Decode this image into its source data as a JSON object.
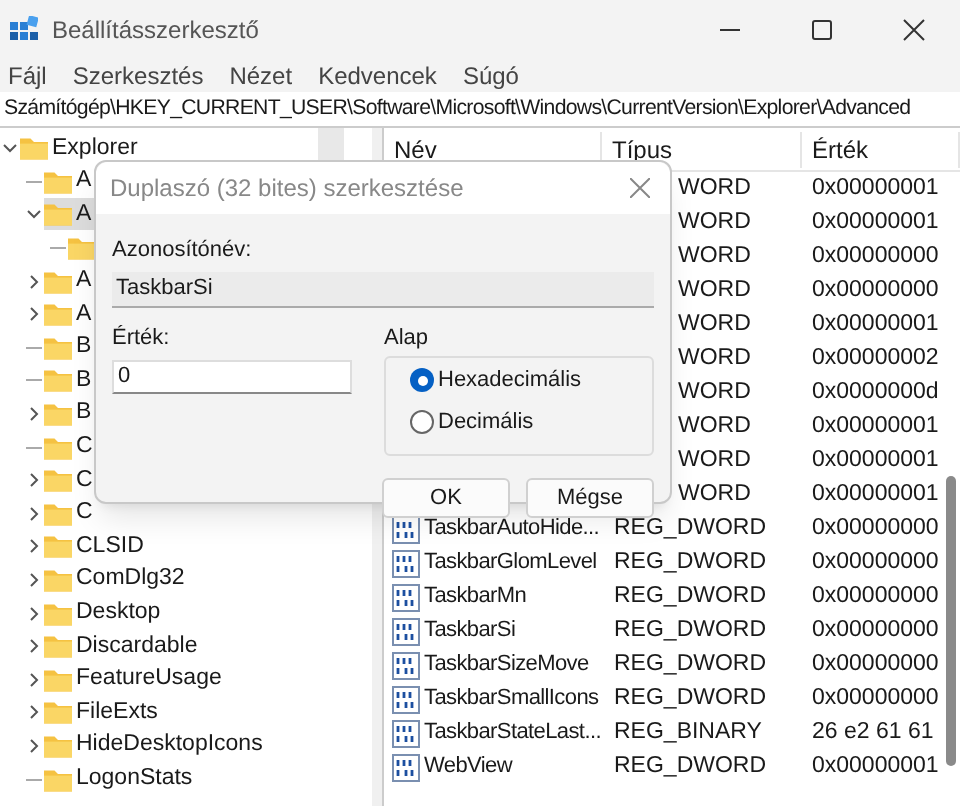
{
  "window": {
    "title": "Beállításszerkesztő"
  },
  "menu": [
    "Fájl",
    "Szerkesztés",
    "Nézet",
    "Kedvencek",
    "Súgó"
  ],
  "address": "Számítógép\\HKEY_CURRENT_USER\\Software\\Microsoft\\Windows\\CurrentVersion\\Explorer\\Advanced",
  "tree": [
    {
      "label": "Explorer",
      "kind": "expandable",
      "expanded": true,
      "selected": false,
      "children": [
        {
          "label": "A",
          "kind": "leaf",
          "selected": false
        },
        {
          "label": "A",
          "kind": "expandable",
          "expanded": true,
          "selected": true,
          "children": [
            {
              "kind": "leaf",
              "selected": false
            }
          ]
        },
        {
          "label": "A",
          "kind": "expandable",
          "expanded": false,
          "selected": false
        },
        {
          "label": "A",
          "kind": "expandable",
          "expanded": false,
          "selected": false
        },
        {
          "label": "B",
          "kind": "leaf",
          "selected": false
        },
        {
          "label": "B",
          "kind": "leaf",
          "selected": false
        },
        {
          "label": "B",
          "kind": "expandable",
          "expanded": false,
          "selected": false
        },
        {
          "label": "C",
          "kind": "leaf",
          "selected": false
        },
        {
          "label": "C",
          "kind": "expandable",
          "expanded": false,
          "selected": false
        },
        {
          "label": "C",
          "kind": "expandable",
          "expanded": false,
          "selected": false
        },
        {
          "label": "CLSID",
          "kind": "expandable",
          "expanded": false,
          "selected": false
        },
        {
          "label": "ComDlg32",
          "kind": "expandable",
          "expanded": false,
          "selected": false
        },
        {
          "label": "Desktop",
          "kind": "expandable",
          "expanded": false,
          "selected": false
        },
        {
          "label": "Discardable",
          "kind": "expandable",
          "expanded": false,
          "selected": false
        },
        {
          "label": "FeatureUsage",
          "kind": "expandable",
          "expanded": false,
          "selected": false
        },
        {
          "label": "FileExts",
          "kind": "expandable",
          "expanded": false,
          "selected": false
        },
        {
          "label": "HideDesktopIcons",
          "kind": "expandable",
          "expanded": false,
          "selected": false
        },
        {
          "label": "LogonStats",
          "kind": "leaf",
          "selected": false
        }
      ]
    }
  ],
  "table": {
    "columns": [
      "Név",
      "Típus",
      "Érték"
    ],
    "rows": [
      {
        "type": "WORD",
        "value": "0x00000001"
      },
      {
        "type": "WORD",
        "value": "0x00000001"
      },
      {
        "type": "WORD",
        "value": "0x00000000"
      },
      {
        "type": "WORD",
        "value": "0x00000000"
      },
      {
        "type": "WORD",
        "value": "0x00000001"
      },
      {
        "type": "WORD",
        "value": "0x00000002"
      },
      {
        "type": "WORD",
        "value": "0x0000000d"
      },
      {
        "type": "WORD",
        "value": "0x00000001"
      },
      {
        "type": "WORD",
        "value": "0x00000001"
      },
      {
        "type": "WORD",
        "value": "0x00000001"
      },
      {
        "name": "TaskbarAutoHide...",
        "type": "REG_DWORD",
        "value": "0x00000000"
      },
      {
        "name": "TaskbarGlomLevel",
        "type": "REG_DWORD",
        "value": "0x00000000"
      },
      {
        "name": "TaskbarMn",
        "type": "REG_DWORD",
        "value": "0x00000000"
      },
      {
        "name": "TaskbarSi",
        "type": "REG_DWORD",
        "value": "0x00000000"
      },
      {
        "name": "TaskbarSizeMove",
        "type": "REG_DWORD",
        "value": "0x00000000"
      },
      {
        "name": "TaskbarSmallIcons",
        "type": "REG_DWORD",
        "value": "0x00000000"
      },
      {
        "name": "TaskbarStateLast...",
        "type": "REG_BINARY",
        "value": "26 e2 61 61"
      },
      {
        "name": "WebView",
        "type": "REG_DWORD",
        "value": "0x00000001"
      }
    ]
  },
  "dialog": {
    "title": "Duplaszó (32 bites) szerkesztése",
    "name_label": "Azonosítónév:",
    "name_value": "TaskbarSi",
    "value_label": "Érték:",
    "value": "0",
    "base_label": "Alap",
    "bases": [
      {
        "label": "Hexadecimális",
        "selected": true
      },
      {
        "label": "Decimális",
        "selected": false
      }
    ],
    "buttons": [
      "OK",
      "Mégse"
    ]
  }
}
